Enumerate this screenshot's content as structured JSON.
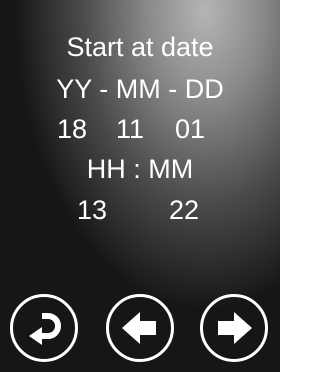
{
  "screen": {
    "title": "Start at date",
    "date_format": "YY - MM - DD",
    "date": {
      "yy": "18",
      "mm": "11",
      "dd": "01"
    },
    "time_format": "HH : MM",
    "time": {
      "hh": "13",
      "mm": "22"
    }
  },
  "buttons": [
    {
      "icon": "return-icon"
    },
    {
      "icon": "arrow-left-icon"
    },
    {
      "icon": "arrow-right-icon"
    }
  ]
}
